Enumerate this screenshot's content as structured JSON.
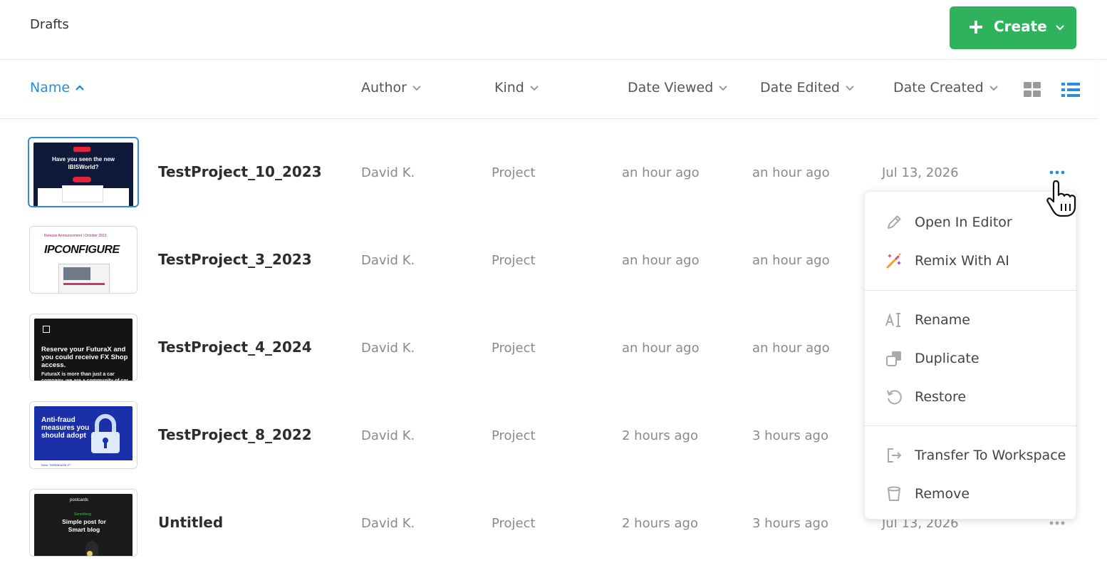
{
  "header": {
    "title": "Drafts",
    "create_label": "Create"
  },
  "columns": {
    "name": "Name",
    "author": "Author",
    "kind": "Kind",
    "date_viewed": "Date Viewed",
    "date_edited": "Date Edited",
    "date_created": "Date Created"
  },
  "rows": [
    {
      "name": "TestProject_10_2023",
      "author": "David K.",
      "kind": "Project",
      "date_viewed": "an hour ago",
      "date_edited": "an hour ago",
      "date_created": "Jul 13, 2026",
      "thumb_text": "Have you seen the new IBISWorld?"
    },
    {
      "name": "TestProject_3_2023",
      "author": "David K.",
      "kind": "Project",
      "date_viewed": "an hour ago",
      "date_edited": "an hour ago",
      "date_created": "",
      "thumb_small": "Release Announcement | October 2023",
      "thumb_text": "IPCONFIGURE"
    },
    {
      "name": "TestProject_4_2024",
      "author": "David K.",
      "kind": "Project",
      "date_viewed": "an hour ago",
      "date_edited": "an hour ago",
      "date_created": "",
      "thumb_text": "Reserve your FuturaX and you could receive FX Shop access.",
      "thumb_sub": "FuturaX is more than just a car company, we are a community of car"
    },
    {
      "name": "TestProject_8_2022",
      "author": "David K.",
      "kind": "Project",
      "date_viewed": "2 hours ago",
      "date_edited": "3 hours ago",
      "date_created": "",
      "thumb_text": "Anti-fraud measures you should adopt",
      "thumb_foot": "Drive \"SHRINKAGE-IT\""
    },
    {
      "name": "Untitled",
      "author": "David K.",
      "kind": "Project",
      "date_viewed": "2 hours ago",
      "date_edited": "3 hours ago",
      "date_created": "Jul 13, 2026",
      "thumb_brand": "postcards",
      "thumb_small": "Something",
      "thumb_text": "Simple post for Smart blog"
    }
  ],
  "context_menu": {
    "items": [
      {
        "label": "Open In Editor",
        "icon": "pencil-icon"
      },
      {
        "label": "Remix With AI",
        "icon": "magic-wand-icon"
      },
      {
        "label": "Rename",
        "icon": "rename-icon"
      },
      {
        "label": "Duplicate",
        "icon": "duplicate-icon"
      },
      {
        "label": "Restore",
        "icon": "restore-icon"
      },
      {
        "label": "Transfer To Workspace",
        "icon": "transfer-icon"
      },
      {
        "label": "Remove",
        "icon": "trash-icon"
      }
    ]
  },
  "colors": {
    "accent": "#2a8fd8",
    "create_button": "#2eb35c"
  }
}
